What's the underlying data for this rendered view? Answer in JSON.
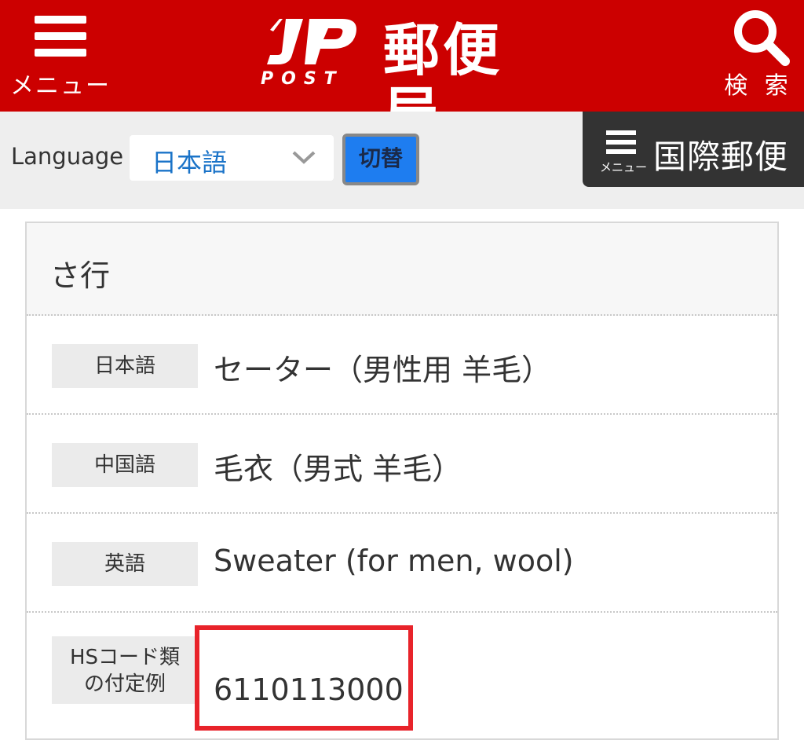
{
  "header": {
    "menu_label": "メニュー",
    "logo_jp": "JP",
    "logo_post": "POST",
    "title": "郵便局",
    "search_label": "検 索",
    "brand_color": "#cc0000"
  },
  "langbar": {
    "language_label": "Language",
    "selected_language": "日本語",
    "switch_label": "切替",
    "intl_menu_small": "メニュー",
    "intl_title": "国際郵便"
  },
  "card": {
    "heading": "さ行",
    "rows": [
      {
        "label": "日本語",
        "value": "セーター（男性用 羊毛）"
      },
      {
        "label": "中国語",
        "value": "毛衣（男式 羊毛）"
      },
      {
        "label": "英語",
        "value": "Sweater (for men, wool)"
      }
    ],
    "hs": {
      "label_line1": "HSコード類",
      "label_line2": "の付定例",
      "value": "6110113000",
      "highlight_color": "#e8232a"
    }
  }
}
